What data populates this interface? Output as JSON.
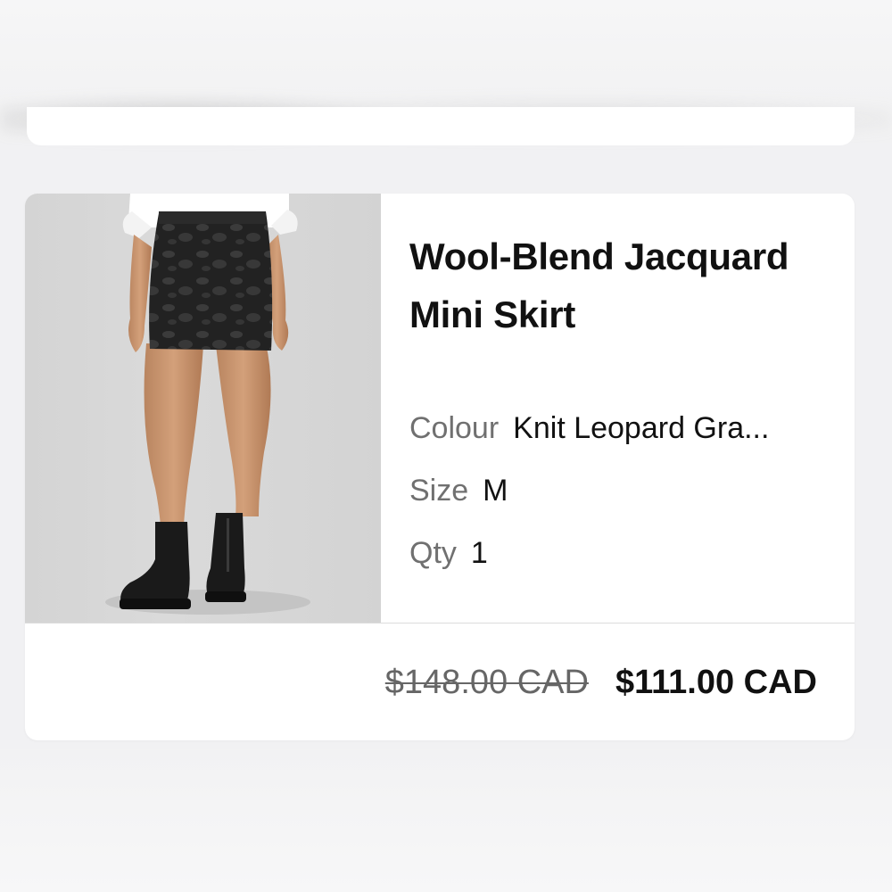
{
  "product": {
    "title": "Wool-Blend Jacquard Mini Skirt",
    "image_icon": "product-photo",
    "attributes": [
      {
        "label": "Colour",
        "value": "Knit Leopard Gra..."
      },
      {
        "label": "Size",
        "value": "M"
      },
      {
        "label": "Qty",
        "value": "1"
      }
    ]
  },
  "price": {
    "original": "$148.00 CAD",
    "sale": "$111.00 CAD"
  }
}
